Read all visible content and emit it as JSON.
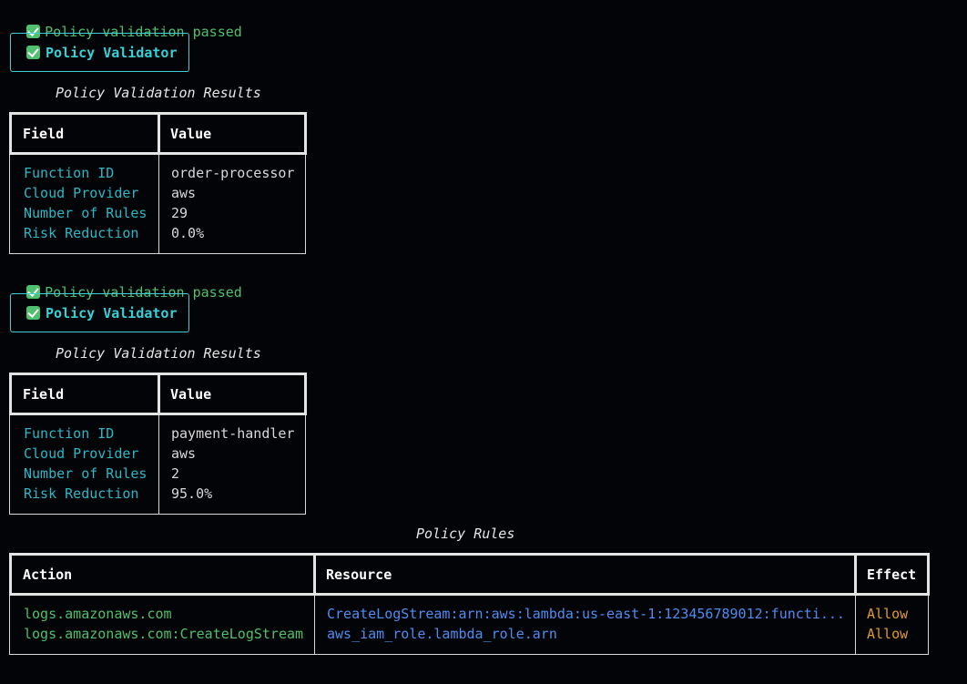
{
  "status_message": "Policy validation passed",
  "panel_title": "Policy Validator",
  "results_caption": "Policy Validation Results",
  "results_columns": [
    "Field",
    "Value"
  ],
  "results": [
    {
      "rows": [
        {
          "field": "Function ID",
          "value": "order-processor"
        },
        {
          "field": "Cloud Provider",
          "value": "aws"
        },
        {
          "field": "Number of Rules",
          "value": "29"
        },
        {
          "field": "Risk Reduction",
          "value": "0.0%"
        }
      ]
    },
    {
      "rows": [
        {
          "field": "Function ID",
          "value": "payment-handler"
        },
        {
          "field": "Cloud Provider",
          "value": "aws"
        },
        {
          "field": "Number of Rules",
          "value": "2"
        },
        {
          "field": "Risk Reduction",
          "value": "95.0%"
        }
      ]
    }
  ],
  "rules_caption": "Policy Rules",
  "rules_columns": [
    "Action",
    "Resource",
    "Effect"
  ],
  "rules": [
    {
      "action": "logs.amazonaws.com",
      "resource": "CreateLogStream:arn:aws:lambda:us-east-1:123456789012:functi...",
      "effect": "Allow"
    },
    {
      "action": "logs.amazonaws.com:CreateLogStream",
      "resource": "aws_iam_role.lambda_role.arn",
      "effect": "Allow"
    }
  ],
  "colors": {
    "background": "#030408",
    "success": "#4ec06b",
    "panel_accent": "#36d0d6",
    "field_label": "#2bb8c4",
    "resource": "#4f8cf0",
    "effect": "#e0992a"
  },
  "icons": {
    "status": "check-mark-icon"
  }
}
